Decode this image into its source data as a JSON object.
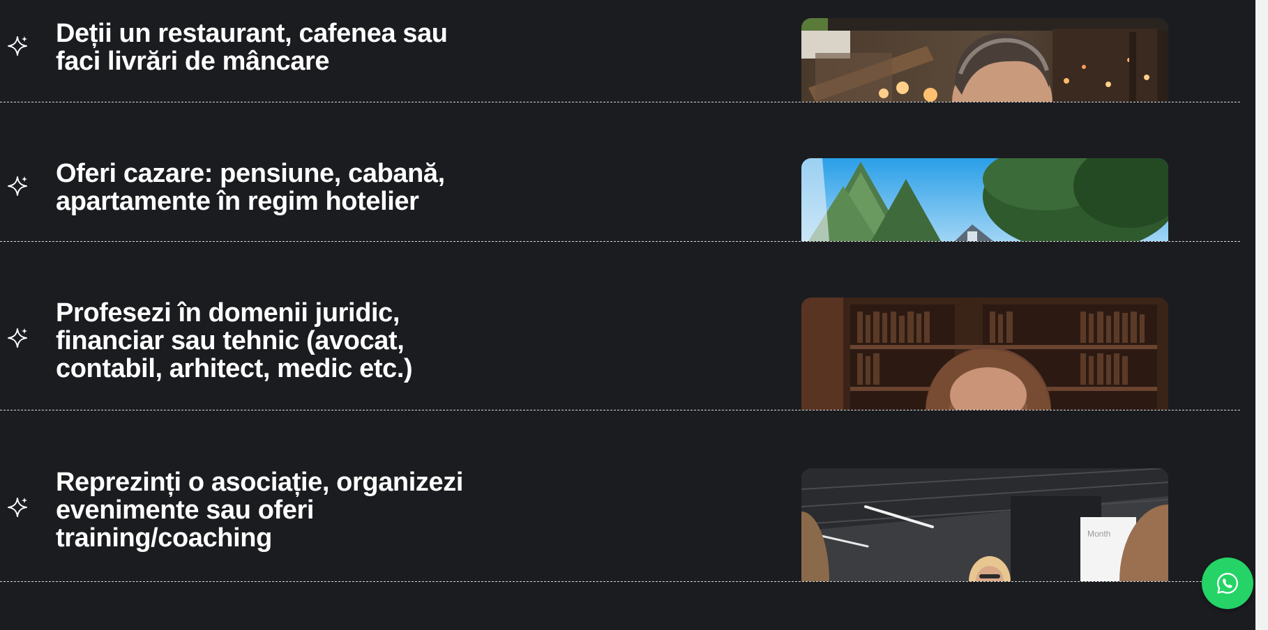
{
  "audiences": [
    {
      "line1": "Deții un restaurant, cafenea sau",
      "line2": "faci livrări de mâncare",
      "line3": "",
      "image_alt": "man-in-restaurant-photo"
    },
    {
      "line1": "Oferi cazare: pensiune, cabană,",
      "line2": "apartamente în regim hotelier",
      "line3": "",
      "image_alt": "mountain-cabin-photo"
    },
    {
      "line1": "Profesezi în domenii juridic,",
      "line2": "financiar sau tehnic (avocat,",
      "line3": "contabil, arhitect, medic etc.)",
      "image_alt": "woman-in-library-office-photo"
    },
    {
      "line1": "Reprezinți o asociație, organizezi",
      "line2": "evenimente sau oferi",
      "line3": "training/coaching",
      "image_alt": "training-session-photo"
    }
  ],
  "whatsapp": {
    "icon": "whatsapp-icon",
    "color": "#25d366"
  },
  "colors": {
    "background": "#1b1c20",
    "text": "#ffffff",
    "divider": "#d8d8d8"
  }
}
